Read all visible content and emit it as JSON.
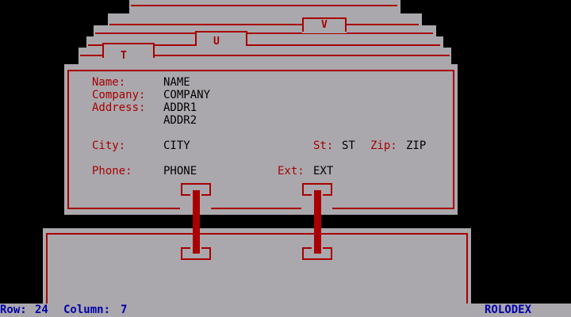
{
  "tabs": {
    "t": "T",
    "u": "U",
    "v": "V"
  },
  "card": {
    "name_label": "Name:",
    "name_value": "NAME",
    "company_label": "Company:",
    "company_value": "COMPANY",
    "address_label": "Address:",
    "addr1_value": "ADDR1",
    "addr2_value": "ADDR2",
    "city_label": "City:",
    "city_value": "CITY",
    "st_label": "St:",
    "st_value": "ST",
    "zip_label": "Zip:",
    "zip_value": "ZIP",
    "phone_label": "Phone:",
    "phone_value": "PHONE",
    "ext_label": "Ext:",
    "ext_value": "EXT"
  },
  "status": {
    "row_label": "Row:",
    "row_value": "24",
    "column_label": "Column:",
    "column_value": "7",
    "app_name": "ROLODEX"
  },
  "colors": {
    "background": "#000000",
    "card": "#aaa8ad",
    "line": "#a80000",
    "status_text": "#0000a8"
  }
}
